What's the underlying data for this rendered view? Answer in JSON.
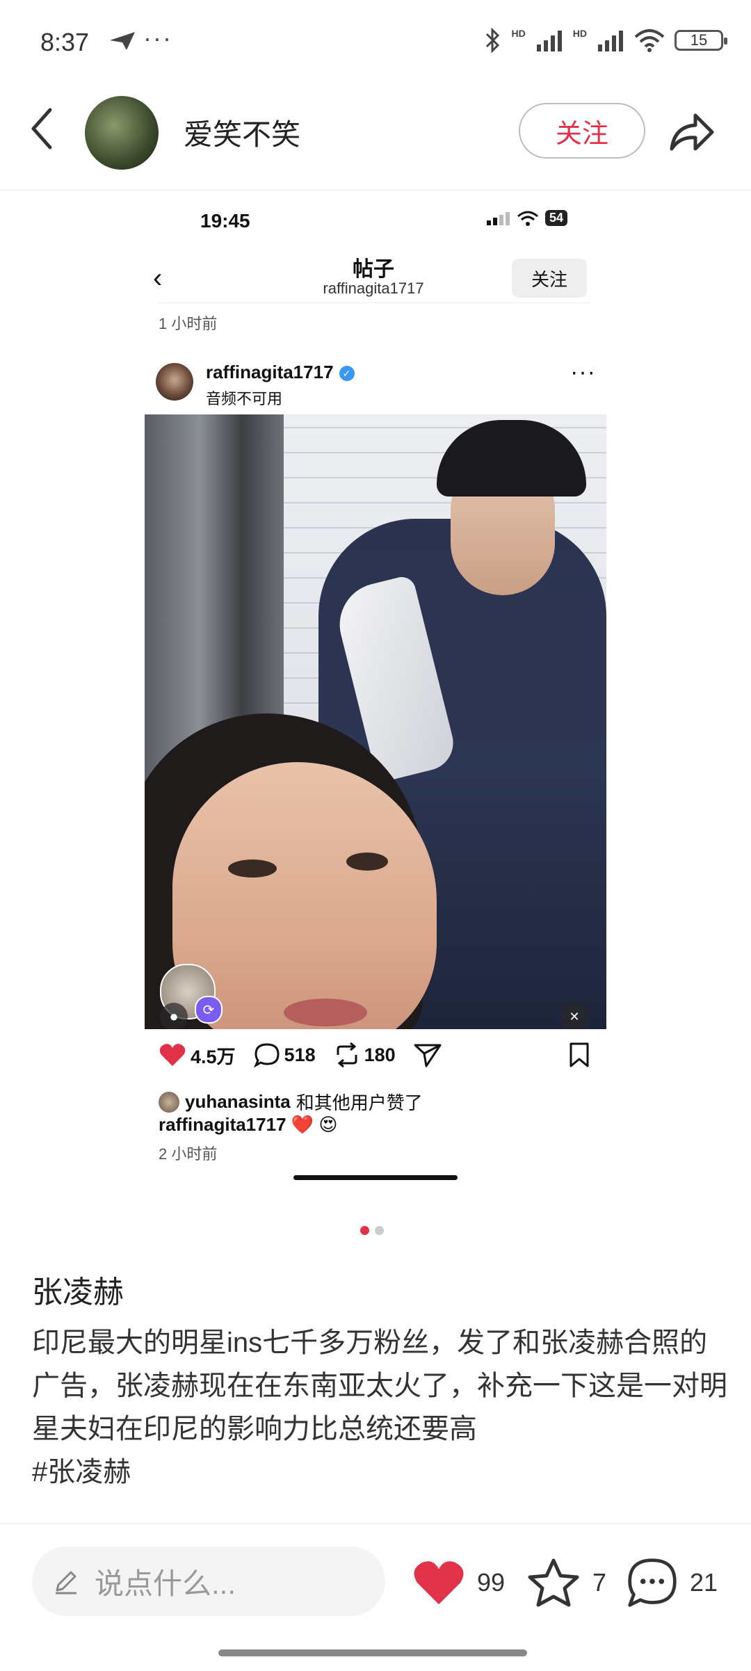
{
  "status_bar": {
    "time": "8:37",
    "more": "···",
    "battery": "15",
    "hd1": "HD",
    "hd2": "HD"
  },
  "header": {
    "author": "爱笑不笑",
    "follow": "关注"
  },
  "embedded": {
    "status_time": "19:45",
    "battery": "54",
    "title": "帖子",
    "subtitle": "raffinagita1717",
    "follow": "关注",
    "time_top": "1 小时前",
    "post_user": "raffinagita1717",
    "audio_status": "音频不可用",
    "likes": "4.5万",
    "comments": "518",
    "reposts": "180",
    "liked_by_user": "yuhanasinta",
    "liked_by_suffix": "和其他用户赞了",
    "caption_user": "raffinagita1717",
    "caption_emojis": "❤️ 😍",
    "time_bottom": "2 小时前"
  },
  "post": {
    "title": "张凌赫",
    "body": "印尼最大的明星ins七千多万粉丝，发了和张凌赫合照的广告，张凌赫现在在东南亚太火了，补充一下这是一对明星夫妇在印尼的影响力比总统还要高",
    "hashtag": "#张凌赫"
  },
  "pager": {
    "total": 2,
    "active": 1
  },
  "bottom_bar": {
    "comment_placeholder": "说点什么...",
    "likes": "99",
    "favorites": "7",
    "comments": "21"
  },
  "colors": {
    "accent": "#e0334a",
    "text": "#222222"
  }
}
